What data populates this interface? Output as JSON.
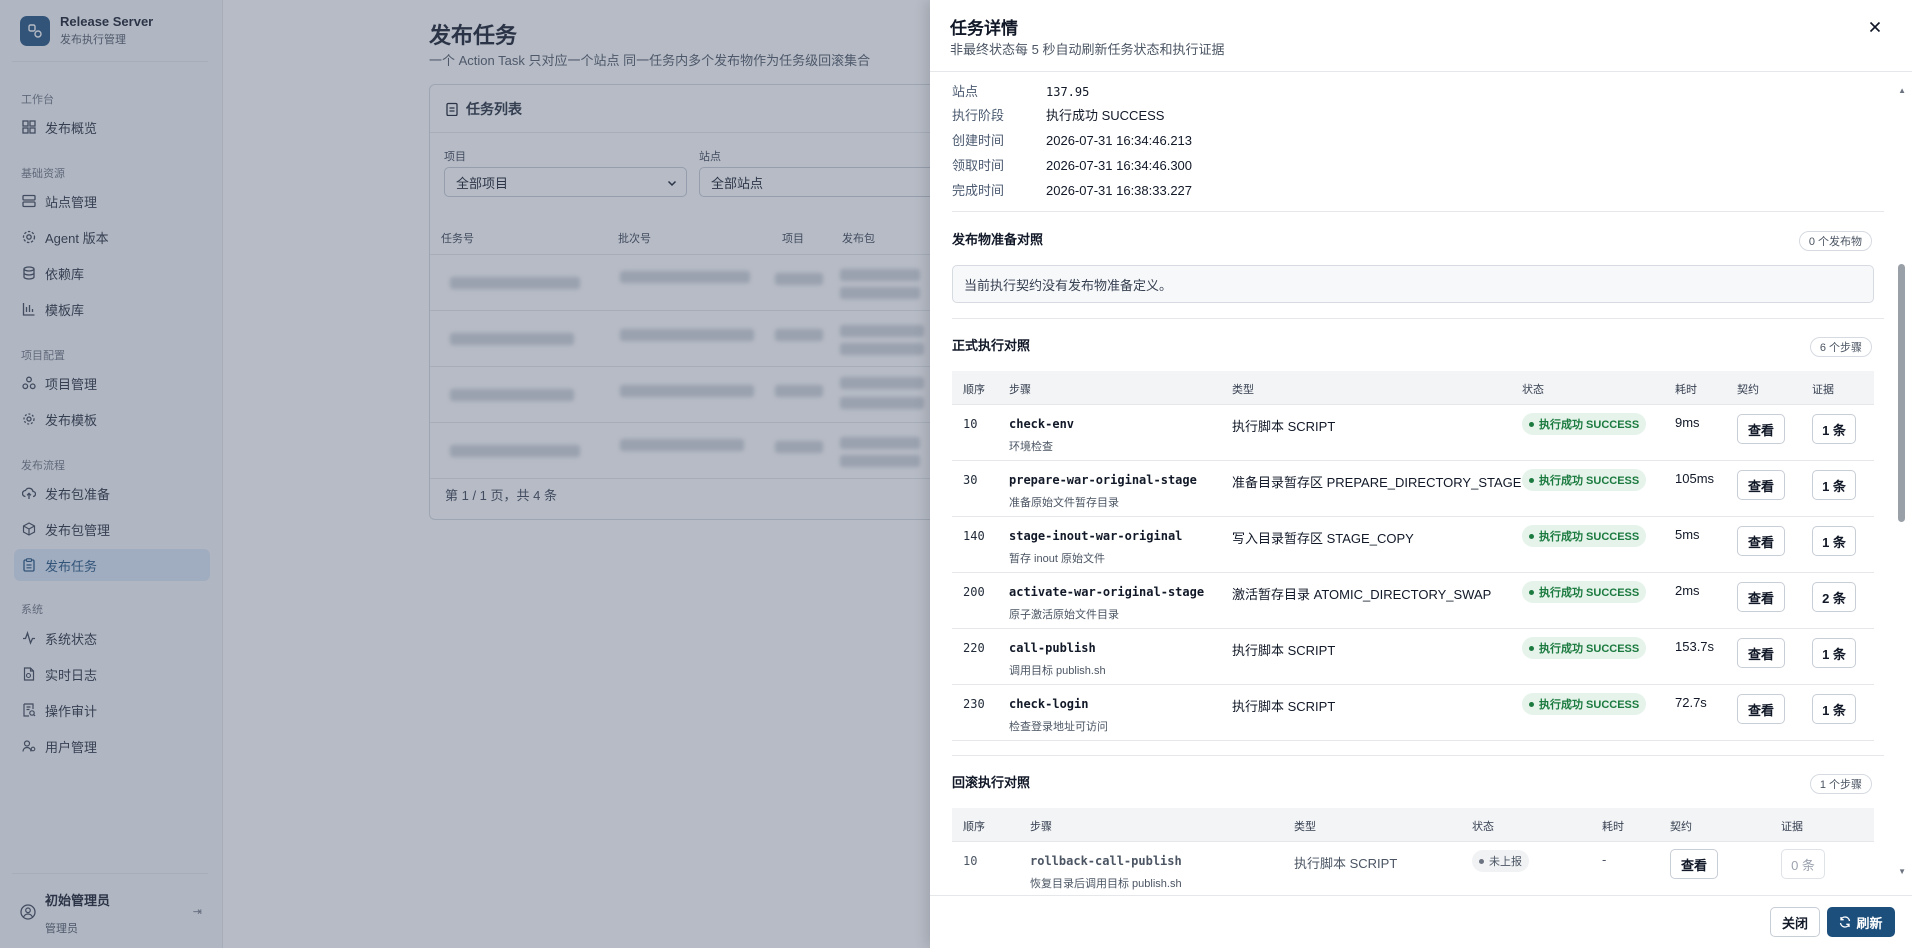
{
  "brand": {
    "title": "Release Server",
    "subtitle": "发布执行管理"
  },
  "sidebar": {
    "sections": [
      {
        "label": "工作台",
        "items": [
          {
            "label": "发布概览",
            "icon": "grid-icon"
          }
        ]
      },
      {
        "label": "基础资源",
        "items": [
          {
            "label": "站点管理",
            "icon": "server-icon"
          },
          {
            "label": "Agent 版本",
            "icon": "cog-icon"
          },
          {
            "label": "依赖库",
            "icon": "database-icon"
          },
          {
            "label": "模板库",
            "icon": "chart-icon"
          }
        ]
      },
      {
        "label": "项目配置",
        "items": [
          {
            "label": "项目管理",
            "icon": "cluster-icon"
          },
          {
            "label": "发布模板",
            "icon": "gear-icon"
          }
        ]
      },
      {
        "label": "发布流程",
        "items": [
          {
            "label": "发布包准备",
            "icon": "upload-cloud-icon"
          },
          {
            "label": "发布包管理",
            "icon": "package-icon"
          },
          {
            "label": "发布任务",
            "icon": "clipboard-icon",
            "active": true
          }
        ]
      },
      {
        "label": "系统",
        "items": [
          {
            "label": "系统状态",
            "icon": "activity-icon"
          },
          {
            "label": "实时日志",
            "icon": "file-icon"
          },
          {
            "label": "操作审计",
            "icon": "audit-icon"
          },
          {
            "label": "用户管理",
            "icon": "users-icon"
          }
        ]
      }
    ],
    "user": {
      "name": "初始管理员",
      "role": "管理员"
    }
  },
  "main": {
    "title": "发布任务",
    "description": "一个 Action Task 只对应一个站点  同一任务内多个发布物作为任务级回滚集合",
    "card_title": "任务列表",
    "filters": [
      {
        "label": "项目",
        "value": "全部项目"
      },
      {
        "label": "站点",
        "value": "全部站点"
      }
    ],
    "columns": [
      "任务号",
      "批次号",
      "项目",
      "发布包"
    ],
    "pager": "第 1 / 1 页，共 4 条"
  },
  "drawer": {
    "title": "任务详情",
    "subtitle": "非最终状态每 5 秒自动刷新任务状态和执行证据",
    "fields": [
      {
        "key": "站点",
        "value": "137.95"
      },
      {
        "key": "执行阶段",
        "value": "执行成功 SUCCESS"
      },
      {
        "key": "创建时间",
        "value": "2026-07-31 16:34:46.213"
      },
      {
        "key": "领取时间",
        "value": "2026-07-31 16:34:46.300"
      },
      {
        "key": "完成时间",
        "value": "2026-07-31 16:38:33.227"
      }
    ],
    "artifacts": {
      "title": "发布物准备对照",
      "count": "0 个发布物",
      "notice": "当前执行契约没有发布物准备定义。"
    },
    "exec": {
      "title": "正式执行对照",
      "count": "6 个步骤",
      "columns": [
        "顺序",
        "步骤",
        "类型",
        "状态",
        "耗时",
        "契约",
        "证据"
      ],
      "rows": [
        {
          "order": "10",
          "name": "check-env",
          "desc": "环境检查",
          "type": "执行脚本 SCRIPT",
          "status": "执行成功 SUCCESS",
          "duration": "9ms",
          "contract": "查看",
          "evidence": "1 条"
        },
        {
          "order": "30",
          "name": "prepare-war-original-stage",
          "desc": "准备原始文件暂存目录",
          "type": "准备目录暂存区 PREPARE_DIRECTORY_STAGE",
          "status": "执行成功 SUCCESS",
          "duration": "105ms",
          "contract": "查看",
          "evidence": "1 条"
        },
        {
          "order": "140",
          "name": "stage-inout-war-original",
          "desc": "暂存 inout 原始文件",
          "type": "写入目录暂存区 STAGE_COPY",
          "status": "执行成功 SUCCESS",
          "duration": "5ms",
          "contract": "查看",
          "evidence": "1 条"
        },
        {
          "order": "200",
          "name": "activate-war-original-stage",
          "desc": "原子激活原始文件目录",
          "type": "激活暂存目录 ATOMIC_DIRECTORY_SWAP",
          "status": "执行成功 SUCCESS",
          "duration": "2ms",
          "contract": "查看",
          "evidence": "2 条"
        },
        {
          "order": "220",
          "name": "call-publish",
          "desc": "调用目标 publish.sh",
          "type": "执行脚本 SCRIPT",
          "status": "执行成功 SUCCESS",
          "duration": "153.7s",
          "contract": "查看",
          "evidence": "1 条"
        },
        {
          "order": "230",
          "name": "check-login",
          "desc": "检查登录地址可访问",
          "type": "执行脚本 SCRIPT",
          "status": "执行成功 SUCCESS",
          "duration": "72.7s",
          "contract": "查看",
          "evidence": "1 条"
        }
      ]
    },
    "rollback": {
      "title": "回滚执行对照",
      "count": "1 个步骤",
      "columns": [
        "顺序",
        "步骤",
        "类型",
        "状态",
        "耗时",
        "契约",
        "证据"
      ],
      "rows": [
        {
          "order": "10",
          "name": "rollback-call-publish",
          "desc": "恢复目录后调用目标 publish.sh",
          "type": "执行脚本 SCRIPT",
          "status": "未上报",
          "duration": "-",
          "contract": "查看",
          "evidence": "0 条"
        }
      ]
    },
    "footer": {
      "close": "关闭",
      "refresh": "刷新"
    }
  },
  "colors": {
    "primary": "#1d4f7c",
    "success_bg": "#e5f3ea",
    "success_text": "#1b7a3f"
  }
}
